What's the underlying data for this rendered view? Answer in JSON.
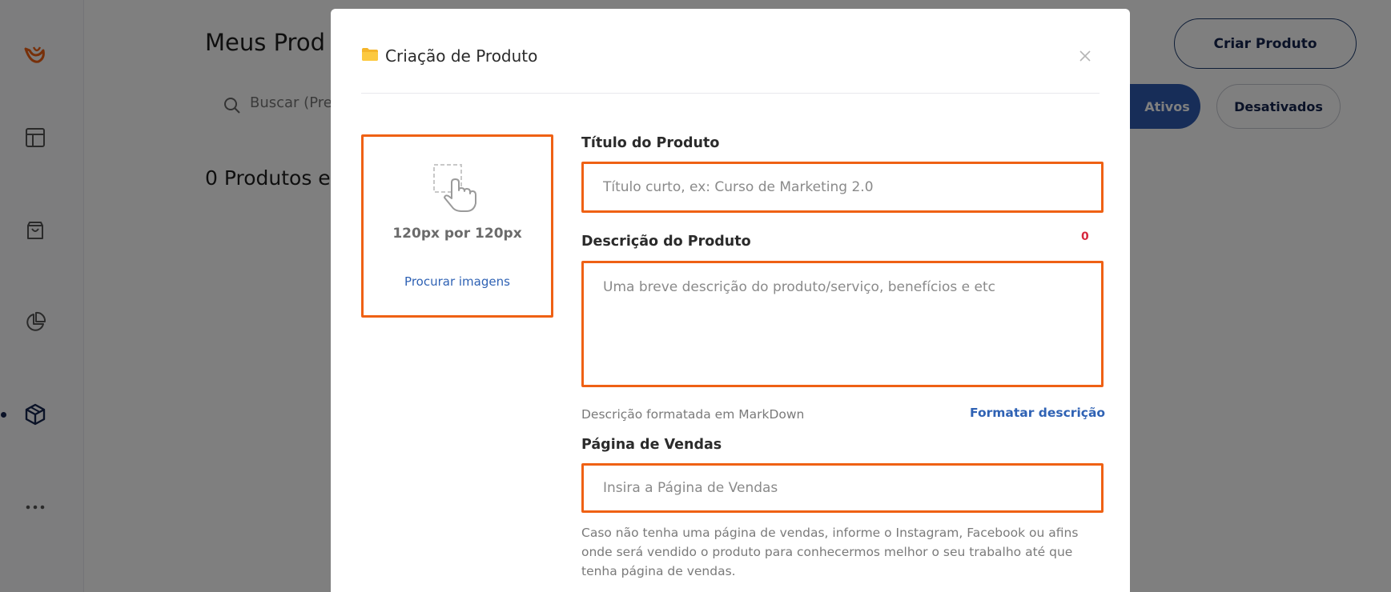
{
  "sidebar": {
    "icons": [
      "logo-icon",
      "layout-icon",
      "shopping-bag-icon",
      "pie-chart-icon",
      "box-icon",
      "more-icon"
    ],
    "accent_color": "#ef6114",
    "active_color": "#14244f"
  },
  "page": {
    "title": "Meus Prod",
    "search_placeholder": "Buscar (Pre",
    "count_text": "0 Produtos e",
    "create_button": "Criar Produto",
    "filter_active": "Ativos",
    "filter_inactive": "Desativados"
  },
  "modal": {
    "title": "Criação de Produto",
    "upload": {
      "size_label": "120px por 120px",
      "browse_link": "Procurar imagens"
    },
    "title_field": {
      "label": "Título do Produto",
      "placeholder": "Título curto, ex: Curso de Marketing 2.0"
    },
    "description_field": {
      "label": "Descrição do Produto",
      "char_count": "0",
      "placeholder": "Uma breve descrição do produto/serviço, benefícios e etc",
      "hint": "Descrição formatada em MarkDown",
      "format_link": "Formatar descrição"
    },
    "sales_page_field": {
      "label": "Página de Vendas",
      "placeholder": "Insira a Página de Vendas",
      "hint": "Caso não tenha uma página de vendas, informe o Instagram, Facebook ou afins onde será vendido o produto para conhecermos melhor o seu trabalho até que tenha página de vendas."
    }
  },
  "colors": {
    "highlight_border": "#ef6114",
    "link": "#2f62b4",
    "error": "#d7263d",
    "primary": "#2f5bb0"
  }
}
